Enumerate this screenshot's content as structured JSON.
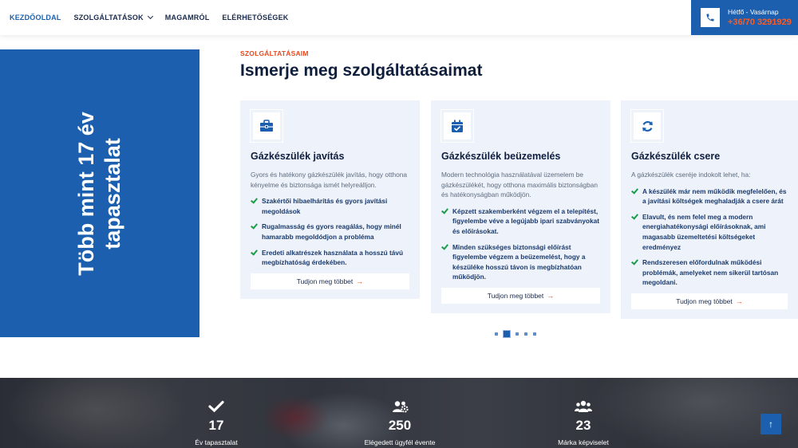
{
  "nav": {
    "items": [
      {
        "label": "KEZDŐOLDAL",
        "active": true
      },
      {
        "label": "SZOLGÁLTATÁSOK",
        "dropdown": true
      },
      {
        "label": "MAGAMRÓL"
      },
      {
        "label": "ELÉRHETŐSÉGEK"
      }
    ],
    "contact": {
      "days": "Hétfő - Vasárnap",
      "phone": "+36/70 3291929",
      "icon": "phone-icon"
    }
  },
  "experience": {
    "line1": "Több mint 17 év",
    "line2": "tapasztalat"
  },
  "services": {
    "eyebrow": "SZOLGÁLTATÁSAIM",
    "title": "Ismerje meg szolgáltatásaimat",
    "cards": [
      {
        "icon": "toolbox-icon",
        "title": "Gázkészülék javítás",
        "desc": "Gyors és hatékony gázkészülék javítás, hogy otthona kényelme és biztonsága ismét helyreálljon.",
        "features": [
          "Szakértői hibaelhárítás és gyors javítási megoldások",
          "Rugalmasság és gyors reagálás, hogy minél hamarabb megoldódjon a probléma",
          "Eredeti alkatrészek használata a hosszú távú megbízhatóság érdekében."
        ],
        "button": "Tudjon meg többet"
      },
      {
        "icon": "calendar-check-icon",
        "title": "Gázkészülék beüzemelés",
        "desc": "Modern technológia használatával üzemelem be gázkészülékét, hogy otthona maximális biztonságban és hatékonyságban működjön.",
        "features": [
          "Képzett szakemberként végzem el a telepítést, figyelembe véve a legújabb ipari szabványokat és előírásokat.",
          "Minden szükséges biztonsági előírást figyelembe végzem a beüzemelést, hogy a készüléke hosszú távon is megbízhatóan működjön."
        ],
        "button": "Tudjon meg többet"
      },
      {
        "icon": "refresh-icon",
        "title": "Gázkészülék csere",
        "desc": "A gázkészülék cseréje indokolt lehet, ha:",
        "features": [
          "A készülék már nem működik megfelelően, és a javítási költségek meghaladják a csere árát",
          "Elavult, és nem felel meg a modern energiahatékonysági előírásoknak, ami magasabb üzemeltetési költségeket eredményez",
          "Rendszeresen előfordulnak működési problémák, amelyeket nem sikerül tartósan megoldani."
        ],
        "button": "Tudjon meg többet"
      }
    ],
    "carousel": {
      "count": 5,
      "active_index": 1
    }
  },
  "stats": [
    {
      "icon": "checkmark-icon",
      "value": "17",
      "label": "Év tapasztalat"
    },
    {
      "icon": "users-gear-icon",
      "value": "250",
      "label": "Elégedett ügyfél évente"
    },
    {
      "icon": "users-icon",
      "value": "23",
      "label": "Márka képviselet"
    }
  ],
  "colors": {
    "brand_blue": "#1b5fae",
    "accent_orange": "#e8491d",
    "check_green": "#1a9c4a",
    "card_bg": "#edf2fb"
  }
}
